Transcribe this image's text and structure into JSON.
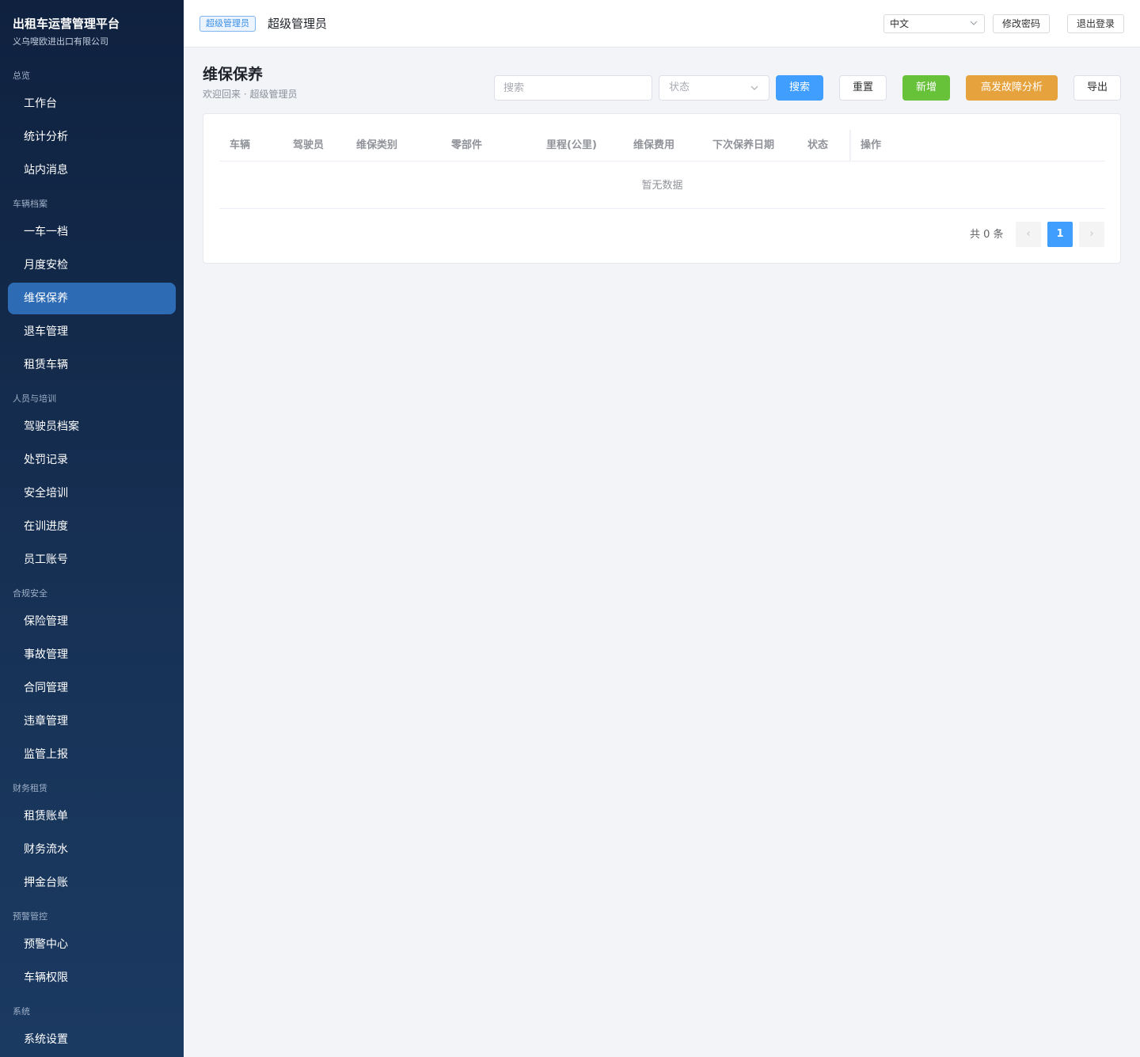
{
  "brand": {
    "title": "出租车运营管理平台",
    "company": "义乌嗖欧进出口有限公司"
  },
  "sidebar": {
    "sections": [
      {
        "label": "总览",
        "items": [
          "工作台",
          "统计分析",
          "站内消息"
        ]
      },
      {
        "label": "车辆档案",
        "items": [
          "一车一档",
          "月度安检",
          "维保保养",
          "退车管理",
          "租赁车辆"
        ]
      },
      {
        "label": "人员与培训",
        "items": [
          "驾驶员档案",
          "处罚记录",
          "安全培训",
          "在训进度",
          "员工账号"
        ]
      },
      {
        "label": "合规安全",
        "items": [
          "保险管理",
          "事故管理",
          "合同管理",
          "违章管理",
          "监管上报"
        ]
      },
      {
        "label": "财务租赁",
        "items": [
          "租赁账单",
          "财务流水",
          "押金台账"
        ]
      },
      {
        "label": "预警管控",
        "items": [
          "预警中心",
          "车辆权限"
        ]
      },
      {
        "label": "系统",
        "items": [
          "系统设置"
        ]
      }
    ],
    "active_item": "维保保养"
  },
  "header": {
    "role_badge": "超级管理员",
    "user_name": "超级管理员",
    "language": "中文",
    "change_password": "修改密码",
    "logout": "退出登录"
  },
  "page": {
    "title": "维保保养",
    "subtitle": "欢迎回来 · 超级管理员"
  },
  "toolbar": {
    "search_placeholder": "搜索",
    "status_placeholder": "状态",
    "search_btn": "搜索",
    "reset_btn": "重置",
    "add_btn": "新增",
    "fault_btn": "高发故障分析",
    "export_btn": "导出"
  },
  "table": {
    "columns": [
      "车辆",
      "驾驶员",
      "维保类别",
      "零部件",
      "里程(公里)",
      "维保费用",
      "下次保养日期",
      "状态",
      "操作"
    ],
    "empty_text": "暂无数据"
  },
  "pagination": {
    "total_text": "共 0 条",
    "current_page": "1",
    "prev_glyph": "‹",
    "next_glyph": "›"
  },
  "colors": {
    "sidebar_top": "#0f213f",
    "sidebar_bottom": "#1b3a62",
    "active_item": "#2e6bb5",
    "primary": "#409eff",
    "success": "#67c23a",
    "warning": "#e6a23c"
  }
}
